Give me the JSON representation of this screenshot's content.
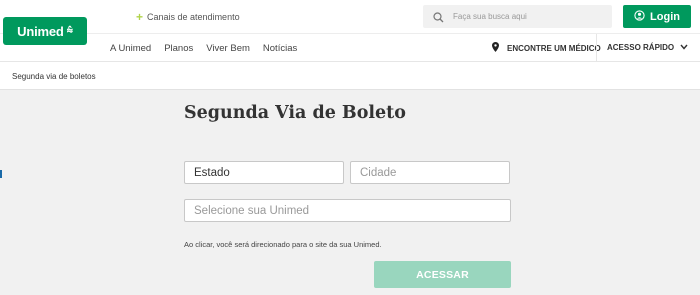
{
  "header": {
    "logo_text": "Unimed",
    "logo_mark": "⩯",
    "canais_label": "Canais de atendimento",
    "search_placeholder": "Faça sua busca aqui",
    "login_label": "Login",
    "nav": [
      "A Unimed",
      "Planos",
      "Viver Bem",
      "Notícias"
    ],
    "encontre_label": "ENCONTRE UM MÉDICO",
    "acesso_label": "ACESSO RÁPIDO"
  },
  "breadcrumb": "Segunda via de boletos",
  "main": {
    "title": "Segunda Via de Boleto",
    "estado": "Estado",
    "cidade": "Cidade",
    "unimed": "Selecione sua Unimed",
    "note": "Ao clicar, você será direcionado para o site da sua Unimed.",
    "button": "ACESSAR"
  },
  "colors": {
    "brand_green": "#00995d",
    "button_disabled": "#99d6be",
    "plus_accent": "#b1d34b"
  },
  "icons": [
    "plus-icon",
    "search-icon",
    "user-icon",
    "location-pin-icon",
    "chevron-down-icon"
  ]
}
